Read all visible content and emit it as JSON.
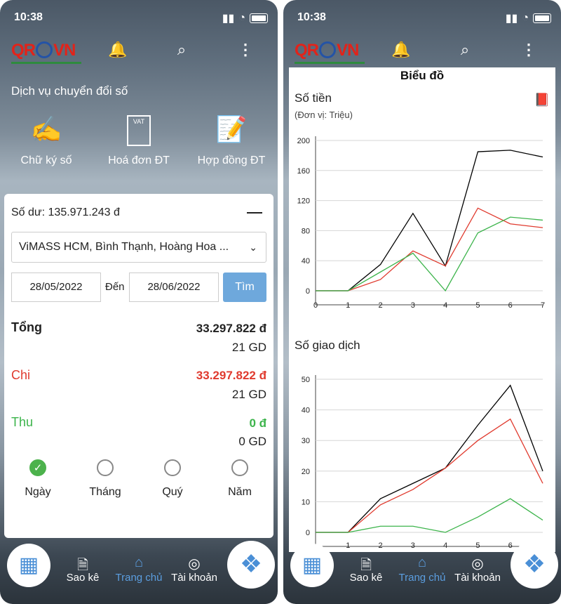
{
  "status": {
    "time": "10:38"
  },
  "logo": {
    "text_left": "QR",
    "text_right": "VN"
  },
  "home": {
    "services_title": "Dịch vụ chuyển đổi số",
    "services": [
      {
        "label": "Chữ ký số",
        "icon": "signature-icon"
      },
      {
        "label": "Hoá đơn ĐT",
        "icon": "invoice-icon"
      },
      {
        "label": "Hợp đồng ĐT",
        "icon": "contract-icon"
      }
    ],
    "invoice_badge": "VAT",
    "balance": "Số dư: 135.971.243 đ",
    "account_select": "ViMASS HCM, Bình Thạnh, Hoàng Hoa ...",
    "date_from": "28/05/2022",
    "date_to_label": "Đến",
    "date_to": "28/06/2022",
    "search_button": "Tìm",
    "totals": [
      {
        "label": "Tổng",
        "amount": "33.297.822 đ",
        "count": "21 GD",
        "color": "#222222"
      },
      {
        "label": "Chi",
        "amount": "33.297.822 đ",
        "count": "21 GD",
        "color": "#e03a2e"
      },
      {
        "label": "Thu",
        "amount": "0 đ",
        "count": "0 GD",
        "color": "#3cb44b"
      }
    ],
    "periods": [
      {
        "label": "Ngày",
        "selected": true
      },
      {
        "label": "Tháng",
        "selected": false
      },
      {
        "label": "Quý",
        "selected": false
      },
      {
        "label": "Năm",
        "selected": false
      }
    ]
  },
  "tabbar": {
    "items": [
      {
        "label": "Sao kê",
        "icon": "statement-icon"
      },
      {
        "label": "Trang chủ",
        "icon": "home-icon",
        "active": true
      },
      {
        "label": "Tài khoản",
        "icon": "account-icon"
      }
    ]
  },
  "charts_page": {
    "title": "Biểu đồ"
  },
  "chart_data": [
    {
      "type": "line",
      "title": "Số tiền",
      "subtitle": "(Đơn vị: Triệu)",
      "x": [
        0,
        1,
        2,
        3,
        4,
        5,
        6,
        7
      ],
      "xlim": [
        0,
        7
      ],
      "ylim": [
        0,
        200
      ],
      "yticks": [
        0,
        40,
        80,
        120,
        160,
        200
      ],
      "xticks": [
        0,
        1,
        2,
        3,
        4,
        5,
        6,
        7
      ],
      "grid": true,
      "series": [
        {
          "color": "#000000",
          "values": [
            0,
            0,
            35,
            103,
            33,
            185,
            187,
            178
          ]
        },
        {
          "color": "#e03a2e",
          "values": [
            0,
            0,
            15,
            53,
            33,
            110,
            89,
            84
          ]
        },
        {
          "color": "#3cb44b",
          "values": [
            0,
            0,
            25,
            50,
            0,
            77,
            98,
            94
          ]
        }
      ]
    },
    {
      "type": "line",
      "title": "Số giao dịch",
      "x": [
        0,
        1,
        2,
        3,
        4,
        5,
        6,
        7
      ],
      "xlim": [
        0,
        7
      ],
      "ylim": [
        0,
        50
      ],
      "yticks": [
        0,
        10,
        20,
        30,
        40,
        50
      ],
      "xticks": [
        1,
        2,
        3,
        4,
        5,
        6
      ],
      "grid": true,
      "series": [
        {
          "color": "#000000",
          "values": [
            0,
            0,
            11,
            16,
            21,
            35,
            48,
            20
          ]
        },
        {
          "color": "#e03a2e",
          "values": [
            0,
            0,
            9,
            14,
            21,
            30,
            37,
            16
          ]
        },
        {
          "color": "#3cb44b",
          "values": [
            0,
            0,
            2,
            2,
            0,
            5,
            11,
            4
          ]
        }
      ]
    }
  ]
}
